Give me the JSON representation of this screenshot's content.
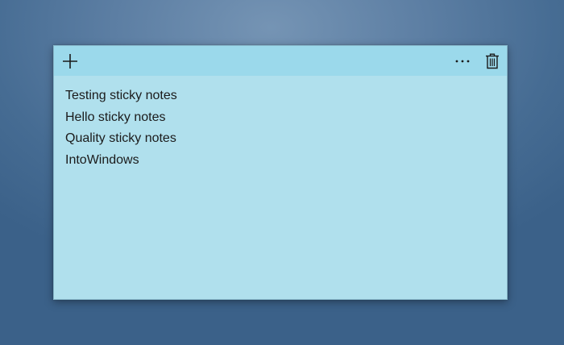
{
  "note": {
    "accent": "#b0e0ed",
    "titlebar_color": "#9bd9eb",
    "buttons": {
      "add": {
        "icon": "plus-icon"
      },
      "more": {
        "icon": "ellipsis-icon"
      },
      "delete": {
        "icon": "trash-icon"
      }
    },
    "lines": [
      "Testing sticky notes",
      "Hello sticky notes",
      "Quality sticky notes",
      "IntoWindows"
    ]
  }
}
